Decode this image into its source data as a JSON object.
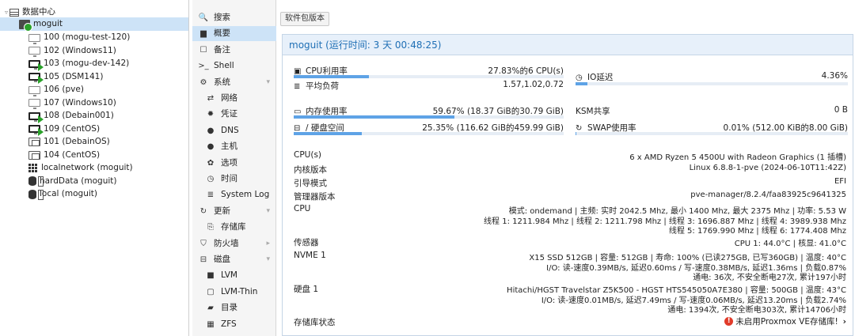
{
  "tree": {
    "datacenter": "数据中心",
    "node": "moguit",
    "items": [
      {
        "label": "100 (mogu-test-120)",
        "kind": "vm"
      },
      {
        "label": "102 (Windows11)",
        "kind": "vm"
      },
      {
        "label": "103 (mogu-dev-142)",
        "kind": "vm-run"
      },
      {
        "label": "105 (DSM141)",
        "kind": "vm-run"
      },
      {
        "label": "106 (pve)",
        "kind": "vm"
      },
      {
        "label": "107 (Windows10)",
        "kind": "vm"
      },
      {
        "label": "108 (Debain001)",
        "kind": "vm-run"
      },
      {
        "label": "109 (CentOS)",
        "kind": "vm-run"
      },
      {
        "label": "101 (DebainOS)",
        "kind": "ct"
      },
      {
        "label": "104 (CentOS)",
        "kind": "ct"
      },
      {
        "label": "localnetwork (moguit)",
        "kind": "net"
      },
      {
        "label": "hardData (moguit)",
        "kind": "storage"
      },
      {
        "label": "local (moguit)",
        "kind": "storage"
      }
    ]
  },
  "menu": [
    {
      "label": "搜索",
      "icon": "search-icon",
      "glyph": "🔍"
    },
    {
      "label": "概要",
      "icon": "book-icon",
      "glyph": "▆",
      "selected": true
    },
    {
      "label": "备注",
      "icon": "notes-icon",
      "glyph": "☐"
    },
    {
      "label": "Shell",
      "icon": "terminal-icon",
      "glyph": ">_"
    },
    {
      "label": "系统",
      "icon": "cogs-icon",
      "glyph": "⚙",
      "expandable": true
    },
    {
      "label": "网络",
      "icon": "exchange-icon",
      "glyph": "⇄",
      "sub": true
    },
    {
      "label": "凭证",
      "icon": "certificate-icon",
      "glyph": "✹",
      "sub": true
    },
    {
      "label": "DNS",
      "icon": "globe-icon",
      "glyph": "●",
      "sub": true
    },
    {
      "label": "主机",
      "icon": "globe-icon",
      "glyph": "●",
      "sub": true
    },
    {
      "label": "选项",
      "icon": "gear-icon",
      "glyph": "✿",
      "sub": true
    },
    {
      "label": "时间",
      "icon": "clock-icon",
      "glyph": "◷",
      "sub": true
    },
    {
      "label": "System Log",
      "icon": "list-icon",
      "glyph": "≣",
      "sub": true
    },
    {
      "label": "更新",
      "icon": "refresh-icon",
      "glyph": "↻",
      "expandable": true
    },
    {
      "label": "存储库",
      "icon": "repository-icon",
      "glyph": "⎘",
      "sub": true
    },
    {
      "label": "防火墙",
      "icon": "shield-icon",
      "glyph": "⛉",
      "expandable": true,
      "collapsed": true
    },
    {
      "label": "磁盘",
      "icon": "hdd-icon",
      "glyph": "⊟",
      "expandable": true
    },
    {
      "label": "LVM",
      "icon": "square-icon",
      "glyph": "■",
      "sub": true
    },
    {
      "label": "LVM-Thin",
      "icon": "square-outline-icon",
      "glyph": "▢",
      "sub": true
    },
    {
      "label": "目录",
      "icon": "folder-icon",
      "glyph": "▰",
      "sub": true
    },
    {
      "label": "ZFS",
      "icon": "th-large-icon",
      "glyph": "▦",
      "sub": true
    }
  ],
  "toolbar": {
    "package_versions": "软件包版本"
  },
  "summary": {
    "title": "moguit (运行时间: 3 天 00:48:25)",
    "cpu_label": "CPU利用率",
    "cpu_value": "27.83%的6 CPU(s)",
    "cpu_fraction": 0.2783,
    "io_label": "IO延迟",
    "io_value": "4.36%",
    "io_fraction": 0.0436,
    "load_label": "平均负荷",
    "load_value": "1.57,1.02,0.72",
    "mem_label": "内存使用率",
    "mem_value": "59.67% (18.37 GiB的30.79 GiB)",
    "mem_fraction": 0.5967,
    "ksm_label": "KSM共享",
    "ksm_value": "0 B",
    "root_label": "/ 硬盘空间",
    "root_value": "25.35% (116.62 GiB的459.99 GiB)",
    "root_fraction": 0.2535,
    "swap_label": "SWAP使用率",
    "swap_value": "0.01% (512.00 KiB的8.00 GiB)",
    "swap_fraction": 0.0001,
    "info": [
      {
        "label": "CPU(s)",
        "lines": [
          "6 x AMD Ryzen 5 4500U with Radeon Graphics (1 插槽)"
        ]
      },
      {
        "label": "内核版本",
        "lines": [
          "Linux 6.8.8-1-pve (2024-06-10T11:42Z)"
        ]
      },
      {
        "label": "引导模式",
        "lines": [
          "EFI"
        ]
      },
      {
        "label": "管理器版本",
        "lines": [
          "pve-manager/8.2.4/faa83925c9641325"
        ]
      },
      {
        "label": "CPU",
        "lines": [
          "模式: ondemand | 主频: 实时 2042.5 Mhz, 最小 1400 Mhz, 最大 2375 Mhz | 功率: 5.53 W",
          "线程 1: 1211.984 Mhz | 线程 2: 1211.798 Mhz | 线程 3: 1696.887 Mhz | 线程 4: 3989.938 Mhz",
          "线程 5: 1769.990 Mhz | 线程 6: 1774.408 Mhz"
        ]
      },
      {
        "label": "传感器",
        "lines": [
          "CPU 1: 44.0°C | 核显: 41.0°C"
        ]
      },
      {
        "label": "NVME 1",
        "lines": [
          "X15 SSD 512GB | 容量: 512GB | 寿命: 100% (已读275GB, 已写360GB) | 温度: 40°C",
          "I/O: 读-速度0.39MB/s, 延迟0.60ms / 写-速度0.38MB/s, 延迟1.36ms | 负载0.87%",
          "通电: 36次, 不安全断电27次, 累计197小时"
        ]
      },
      {
        "label": "硬盘 1",
        "lines": [
          "Hitachi/HGST Travelstar Z5K500 - HGST HTS545050A7E380 | 容量: 500GB | 温度: 43°C",
          "I/O: 读-速度0.01MB/s, 延迟7.49ms / 写-速度0.06MB/s, 延迟13.20ms | 负载2.74%",
          "通电: 1394次, 不安全断电303次, 累计14706小时"
        ]
      }
    ],
    "repo_label": "存储库状态",
    "repo_value": "未启用Proxmox VE存储库!",
    "colors": {
      "accent": "#1f6fb5",
      "bar": "#5ea3e6",
      "warn": "#e13b2a",
      "running": "#2aa12a"
    }
  }
}
